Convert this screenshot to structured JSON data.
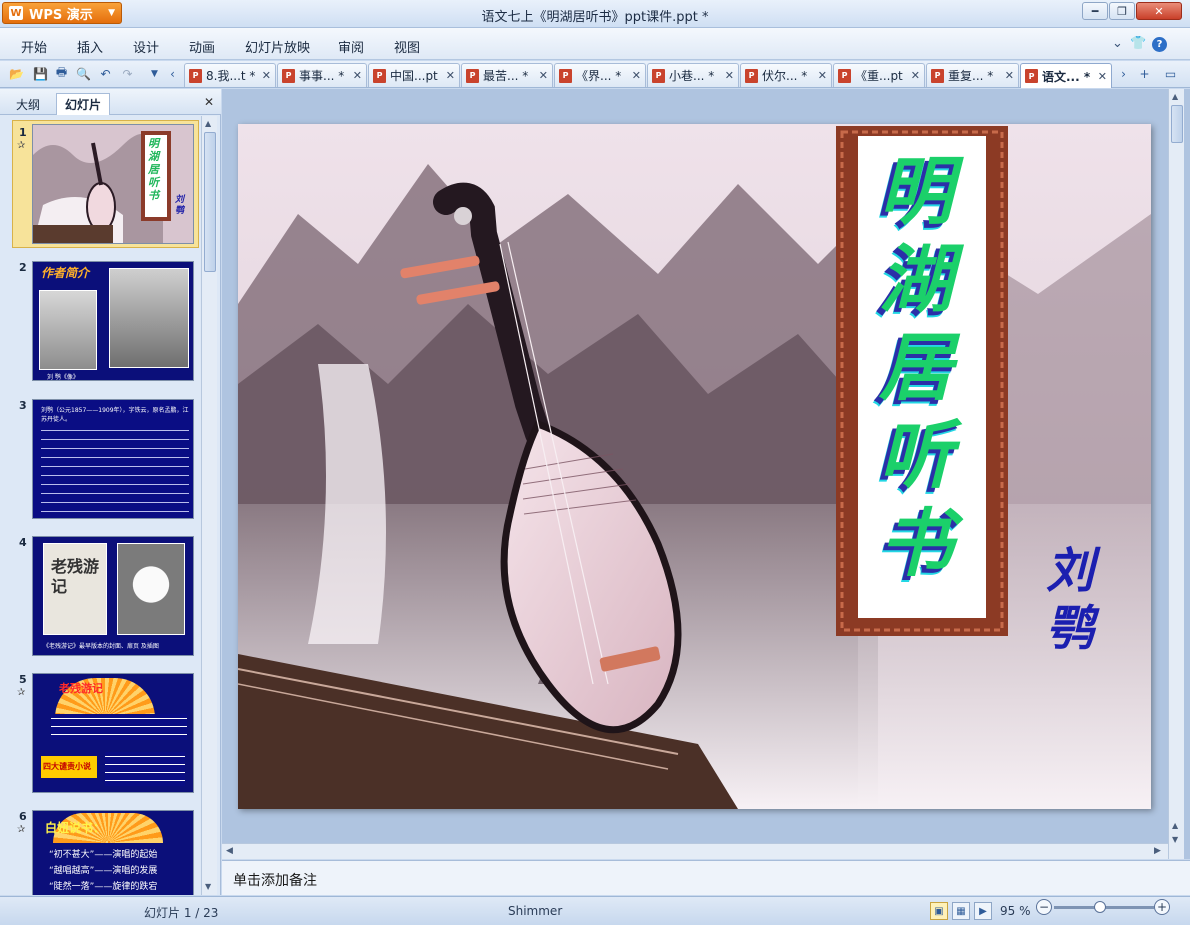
{
  "app": {
    "brand_label": "WPS 演示",
    "window_title": "语文七上《明湖居听书》ppt课件.ppt *"
  },
  "menu": {
    "items": [
      "开始",
      "插入",
      "设计",
      "动画",
      "幻灯片放映",
      "审阅",
      "视图"
    ]
  },
  "doc_tabs": [
    {
      "label": "8.我...t *",
      "active": false
    },
    {
      "label": "事事... *",
      "active": false
    },
    {
      "label": "中国...pt",
      "active": false
    },
    {
      "label": "最苦... *",
      "active": false
    },
    {
      "label": "《界... *",
      "active": false
    },
    {
      "label": "小巷... *",
      "active": false
    },
    {
      "label": "伏尔... *",
      "active": false
    },
    {
      "label": "《重...pt",
      "active": false
    },
    {
      "label": "重复... *",
      "active": false
    },
    {
      "label": "语文... *",
      "active": true
    }
  ],
  "left_panel": {
    "tab_outline": "大纲",
    "tab_slides": "幻灯片",
    "thumbnails": [
      {
        "num": "1",
        "title": "明湖居听书",
        "caption": "刘鹗"
      },
      {
        "num": "2",
        "title": "作者简介",
        "caption": "刘 鹗《像》"
      },
      {
        "num": "3",
        "title": "",
        "caption": "刘鹗（公元1857——1909年），字铁云，原名孟鹏，江苏丹徒人。"
      },
      {
        "num": "4",
        "title": "老残游记",
        "caption": "《老残游记》最早版本的封面、扉页 及插图"
      },
      {
        "num": "5",
        "title": "老残游记",
        "caption": "四大谴责小说"
      },
      {
        "num": "6",
        "title": "白妞说书：",
        "lines": [
          "“初不甚大”——演唱的起始",
          "“越唱越高”——演唱的发展",
          "“陡然一落”——旋律的跌宕"
        ]
      }
    ]
  },
  "slide": {
    "title": "明湖居听书",
    "author": "刘鹗"
  },
  "notes_placeholder": "单击添加备注",
  "status": {
    "slide_counter": "幻灯片 1 / 23",
    "theme": "Shimmer",
    "zoom": "95 %",
    "zoom_level_percent": 95
  }
}
